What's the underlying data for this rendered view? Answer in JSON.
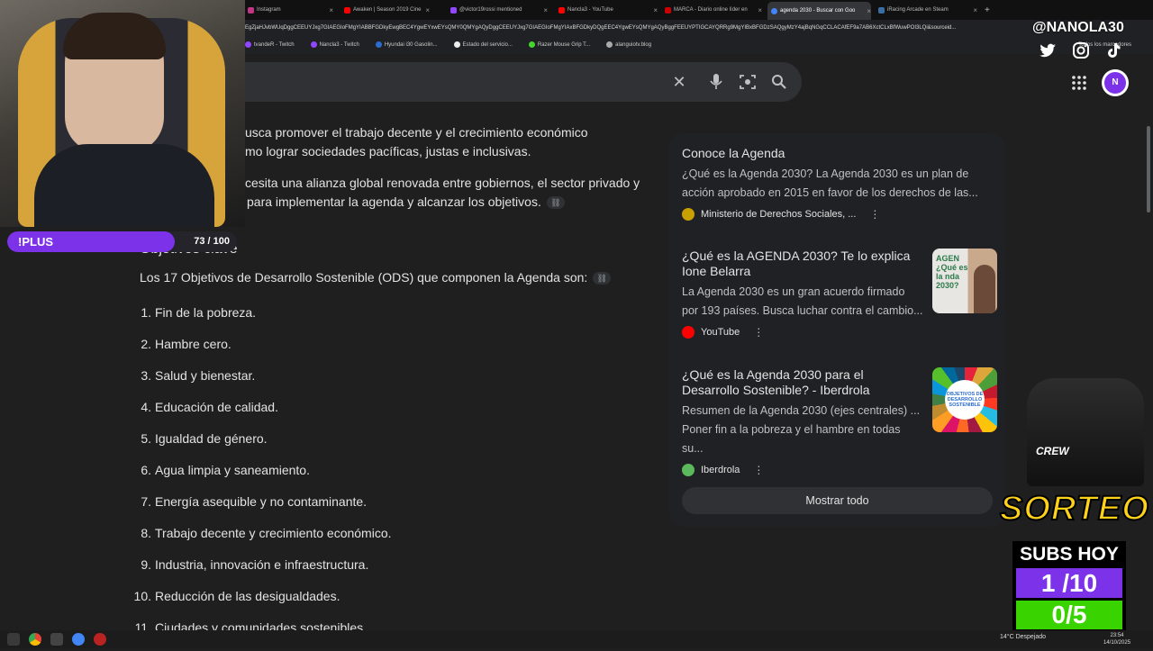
{
  "browser": {
    "tabs": [
      {
        "label": "Instagram",
        "color": "#c13584"
      },
      {
        "label": "Awaken | Season 2019 Cine",
        "color": "#ff0000"
      },
      {
        "label": "@victor19rossi mentioned",
        "color": "#9146ff"
      },
      {
        "label": "Nancla3 - YouTube",
        "color": "#ff0000"
      },
      {
        "label": "MARCA - Diario online líder en",
        "color": "#cc0000"
      },
      {
        "label": "agenda 2030 - Buscar con Goo",
        "color": "#4285f4"
      },
      {
        "label": "iRacing Arcade en Steam",
        "color": "#1b2838"
      }
    ],
    "url": "EgZjaHJvbWUqDggCEEUYJxg7GIAEGIoFMgYIABBFGDkyEwgBEC4YgwEYxwEYsQMY0QMYgAQyDggCEEUYJxg7GIAEGIoFMgYIAxBFGDkyDQgEEC4YgwEYsQMYgAQyBggFEEUYPTIGCAYQRRg9MgYIBxBFGDzSAQgyMzY4ajBqNGqCCLACAfEF9a7AB6XctCLxBfWuwPOI3LQi&sourceid...",
    "bookmarks": [
      "Twitch",
      "tvandeR - Twitch",
      "Nancla3 - Twitch",
      "Hyundai i30 Gasolin...",
      "Estado del servicio...",
      "Razer Mouse Grip T...",
      "alanguiotv.blog"
    ],
    "bookmarks_right": "Todos los marcadores",
    "new_tab": "+"
  },
  "search": {
    "clear_icon": "✕",
    "mic_icon": "🎤",
    "lens_icon": "⌾",
    "search_icon": "⚲"
  },
  "main": {
    "line1": "usca promover el trabajo decente y el crecimiento económico",
    "line2": "mo lograr sociedades pacíficas, justas e inclusivas.",
    "line3": "cesita una alianza global renovada entre gobiernos, el sector privado y",
    "line4": "para implementar la agenda y alcanzar los objetivos.",
    "section_title": "Objetivos clave",
    "intro": "Los 17 Objetivos de Desarrollo Sostenible (ODS) que componen la Agenda son:",
    "link_icon": "🔗",
    "ods": [
      {
        "num": "1.",
        "text": "Fin de la pobreza."
      },
      {
        "num": "2.",
        "text": "Hambre cero."
      },
      {
        "num": "3.",
        "text": "Salud y bienestar."
      },
      {
        "num": "4.",
        "text": "Educación de calidad."
      },
      {
        "num": "5.",
        "text": "Igualdad de género."
      },
      {
        "num": "6.",
        "text": "Agua limpia y saneamiento."
      },
      {
        "num": "7.",
        "text": "Energía asequible y no contaminante."
      },
      {
        "num": "8.",
        "text": "Trabajo decente y crecimiento económico."
      },
      {
        "num": "9.",
        "text": "Industria, innovación e infraestructura."
      },
      {
        "num": "10.",
        "text": "Reducción de las desigualdades."
      },
      {
        "num": "11.",
        "text": "Ciudades y comunidades sostenibles."
      }
    ]
  },
  "side": {
    "cards": [
      {
        "title": "Conoce la Agenda",
        "desc": "¿Qué es la Agenda 2030? La Agenda 2030 es un plan de acción aprobado en 2015 en favor de los derechos de las...",
        "source": "Ministerio de Derechos Sociales, ...",
        "source_color": "#c8a000"
      },
      {
        "title": "¿Qué es la AGENDA 2030? Te lo explica Ione Belarra",
        "desc": "La Agenda 2030 es un gran acuerdo firmado por 193 países. Busca luchar contra el cambio...",
        "source": "YouTube",
        "source_color": "#ff0000",
        "thumb_text": "AGEN ¿Qué es la nda 2030?"
      },
      {
        "title": "¿Qué es la Agenda 2030 para el Desarrollo Sostenible? - Iberdrola",
        "desc": "Resumen de la Agenda 2030 (ejes centrales) ... Poner fin a la pobreza y el hambre en todas su...",
        "source": "Iberdrola",
        "source_color": "#5cb85c",
        "thumb_text": "OBJETIVOS DE DESARROLLO SOSTENIBLE"
      }
    ],
    "more_icon": "⋮",
    "show_all": "Mostrar todo"
  },
  "overlay": {
    "plus_label": "!PLUS",
    "plus_count": "73 / 100",
    "plus_progress": 0.73,
    "handle": "@NANOLA30",
    "sorteo": "SORTEO",
    "crew": "CREW",
    "subs_title": "SUBS HOY",
    "subs_a": "1 /10",
    "subs_b": "0/5"
  },
  "taskbar": {
    "weather": "14°C  Despejado",
    "time": "23:54",
    "date": "14/10/2025"
  }
}
